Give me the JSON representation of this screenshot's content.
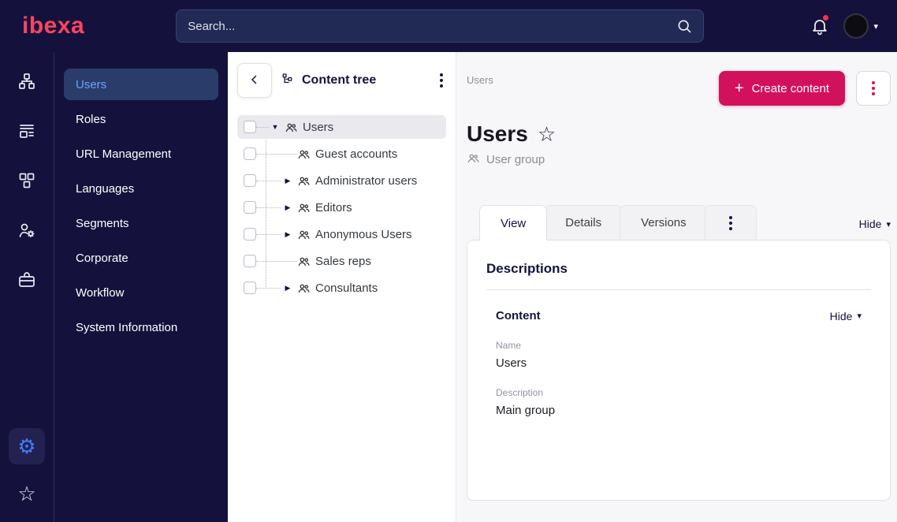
{
  "icons": {
    "caret_down": "▼",
    "caret_right": "▶",
    "dropdown_caret": "▾",
    "plus": "+",
    "gear": "⚙",
    "star": "☆"
  },
  "colors": {
    "brand_logo": "#fb4460",
    "accent": "#d2115c",
    "navy": "#14123c",
    "active_blue": "#3f7dff"
  },
  "topbar": {
    "logo": "ibexa",
    "search_placeholder": "Search..."
  },
  "sidebar": {
    "items": [
      {
        "label": "Users",
        "active": true
      },
      {
        "label": "Roles"
      },
      {
        "label": "URL Management"
      },
      {
        "label": "Languages"
      },
      {
        "label": "Segments"
      },
      {
        "label": "Corporate"
      },
      {
        "label": "Workflow"
      },
      {
        "label": "System Information"
      }
    ]
  },
  "content_tree": {
    "title": "Content tree",
    "items": [
      {
        "label": "Users",
        "depth": 0,
        "expanded": true,
        "selected": true
      },
      {
        "label": "Guest accounts",
        "depth": 1,
        "leaf": true
      },
      {
        "label": "Administrator users",
        "depth": 1
      },
      {
        "label": "Editors",
        "depth": 1
      },
      {
        "label": "Anonymous Users",
        "depth": 1
      },
      {
        "label": "Sales reps",
        "depth": 1,
        "leaf": true
      },
      {
        "label": "Consultants",
        "depth": 1
      }
    ]
  },
  "main": {
    "breadcrumb": "Users",
    "create_button": "Create content",
    "title": "Users",
    "content_type": "User group",
    "tabs": [
      {
        "label": "View",
        "active": true
      },
      {
        "label": "Details"
      },
      {
        "label": "Versions"
      }
    ],
    "hide_toggle": "Hide",
    "card": {
      "heading": "Descriptions",
      "section": {
        "title": "Content",
        "hide_toggle": "Hide",
        "fields": [
          {
            "label": "Name",
            "value": "Users"
          },
          {
            "label": "Description",
            "value": "Main group"
          }
        ]
      }
    }
  }
}
